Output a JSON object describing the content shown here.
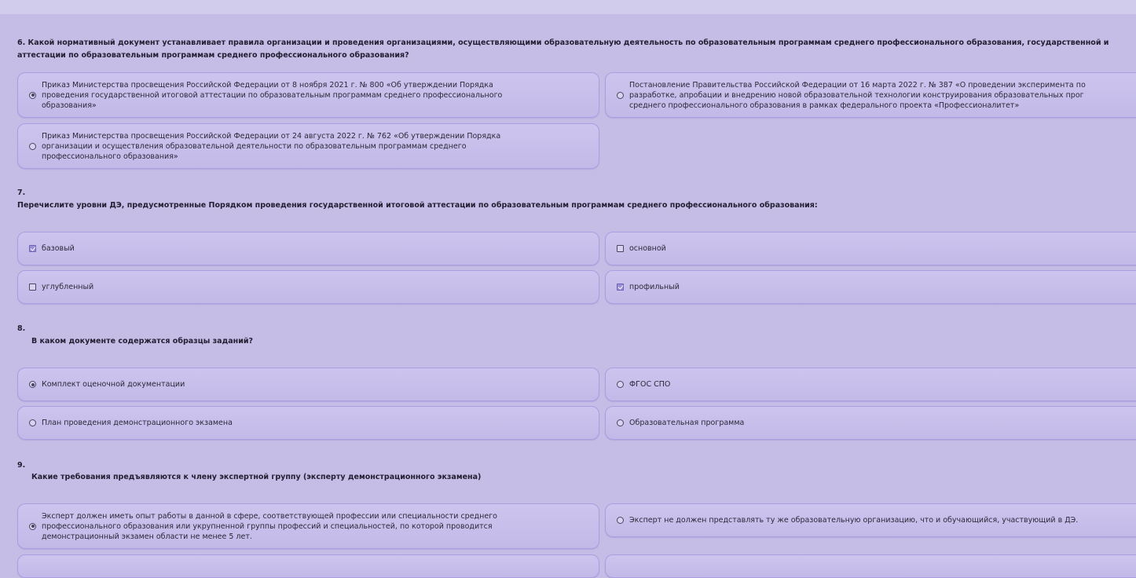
{
  "q6": {
    "text_line1": "6.  Какой нормативный документ устанавливает правила организации и проведения организациями, осуществляющими образовательную деятельность по образовательным программам среднего профессионального образования, государственной и",
    "text_line2": "аттестации по образовательным программам среднего профессионального образования?",
    "options": [
      {
        "label": "Приказ Министерства просвещения Российской Федерации от 8 ноября 2021 г. № 800 «Об утверждении Порядка\nпроведения государственной итоговой аттестации по образовательным программам среднего профессионального\nобразования»",
        "selected": true
      },
      {
        "label": "Постановление Правительства Российской Федерации от 16 марта 2022 г. № 387 «О проведении эксперимента по\nразработке, апробации и внедрению новой образовательной технологии конструирования образовательных прог\nсреднего профессионального образования в рамках федерального проекта «Профессионалитет»",
        "selected": false
      },
      {
        "label": "Приказ Министерства просвещения Российской Федерации от 24 августа 2022 г. № 762 «Об утверждении Порядка\nорганизации и осуществления образовательной деятельности по образовательным программам среднего\nпрофессионального образования»",
        "selected": false
      }
    ]
  },
  "q7": {
    "number": "7.",
    "text": "Перечислите уровни ДЭ, предусмотренные Порядком проведения государственной итоговой аттестации по образовательным программам среднего профессионального образования:",
    "options": [
      {
        "label": "базовый",
        "checked": true
      },
      {
        "label": "основной",
        "checked": false
      },
      {
        "label": "углубленный",
        "checked": false
      },
      {
        "label": "профильный",
        "checked": true
      }
    ]
  },
  "q8": {
    "number": "8.",
    "text": "В каком документе содержатся образцы заданий?",
    "options": [
      {
        "label": "Комплект оценочной документации",
        "selected": true
      },
      {
        "label": "ФГОС СПО",
        "selected": false
      },
      {
        "label": "План проведения демонстрационного экзамена",
        "selected": false
      },
      {
        "label": "Образовательная программа",
        "selected": false
      }
    ]
  },
  "q9": {
    "number": "9.",
    "text": "Какие требования предъявляются к члену экспертной группу (эксперту демонстрационного экзамена)",
    "options": [
      {
        "label": "Эксперт должен иметь опыт работы в данной в сфере, соответствующей профессии или специальности среднего\nпрофессионального образования или укрупненной группы профессий и специальностей, по которой проводится\nдемонстрационный экзамен области не менее 5 лет.",
        "selected": true
      },
      {
        "label": "Эксперт не должен представлять ту же образовательную организацию, что и обучающийся, участвующий в ДЭ.",
        "selected": false
      }
    ]
  }
}
